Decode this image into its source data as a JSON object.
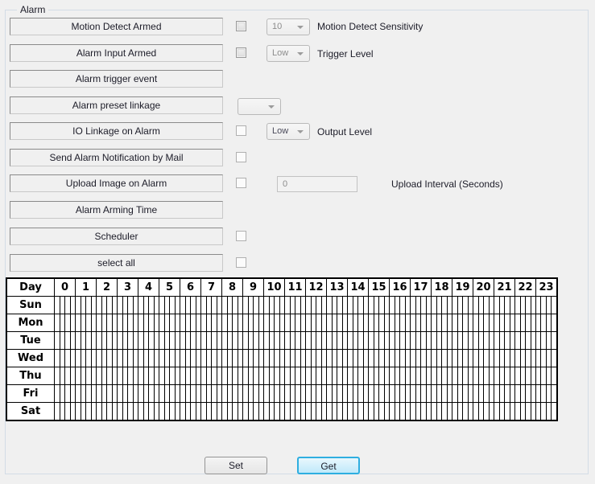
{
  "group": {
    "title": "Alarm"
  },
  "rows": [
    {
      "label": "Motion Detect Armed",
      "checkbox": true,
      "checkbox_disabled": true,
      "combo": "10",
      "combo_disabled": true,
      "caption": "Motion Detect Sensitivity"
    },
    {
      "label": "Alarm Input Armed",
      "checkbox": true,
      "checkbox_disabled": true,
      "combo": "Low",
      "combo_disabled": true,
      "caption": "Trigger Level"
    },
    {
      "label": "Alarm trigger event",
      "checkbox": false,
      "checkbox_disabled": false,
      "combo": null,
      "combo_disabled": false,
      "caption": ""
    },
    {
      "label": "Alarm preset linkage",
      "checkbox": false,
      "checkbox_disabled": false,
      "combo": "",
      "combo_disabled": false,
      "caption": ""
    },
    {
      "label": "IO Linkage on Alarm",
      "checkbox": true,
      "checkbox_disabled": false,
      "combo": "Low",
      "combo_disabled": false,
      "caption": "Output Level"
    },
    {
      "label": "Send Alarm Notification by Mail",
      "checkbox": true,
      "checkbox_disabled": false,
      "combo": null,
      "combo_disabled": false,
      "caption": ""
    },
    {
      "label": "Upload Image on Alarm",
      "checkbox": true,
      "checkbox_disabled": false,
      "combo": null,
      "combo_disabled": false,
      "caption": "Upload Interval (Seconds)",
      "textfield": "0"
    },
    {
      "label": "Alarm Arming Time",
      "checkbox": false,
      "checkbox_disabled": false,
      "combo": null,
      "combo_disabled": false,
      "caption": ""
    },
    {
      "label": "Scheduler",
      "checkbox": true,
      "checkbox_disabled": false,
      "combo": null,
      "combo_disabled": false,
      "caption": ""
    },
    {
      "label": "select all",
      "checkbox": true,
      "checkbox_disabled": false,
      "combo": null,
      "combo_disabled": false,
      "caption": ""
    }
  ],
  "schedule": {
    "day_header": "Day",
    "hours": [
      "0",
      "1",
      "2",
      "3",
      "4",
      "5",
      "6",
      "7",
      "8",
      "9",
      "10",
      "11",
      "12",
      "13",
      "14",
      "15",
      "16",
      "17",
      "18",
      "19",
      "20",
      "21",
      "22",
      "23"
    ],
    "days": [
      "Sun",
      "Mon",
      "Tue",
      "Wed",
      "Thu",
      "Fri",
      "Sat"
    ],
    "slots_per_hour": 4
  },
  "buttons": {
    "set": "Set",
    "get": "Get"
  },
  "colors": {
    "background": "#f0f0f0",
    "focus_border": "#2eaee0",
    "grid_line": "#000000"
  }
}
